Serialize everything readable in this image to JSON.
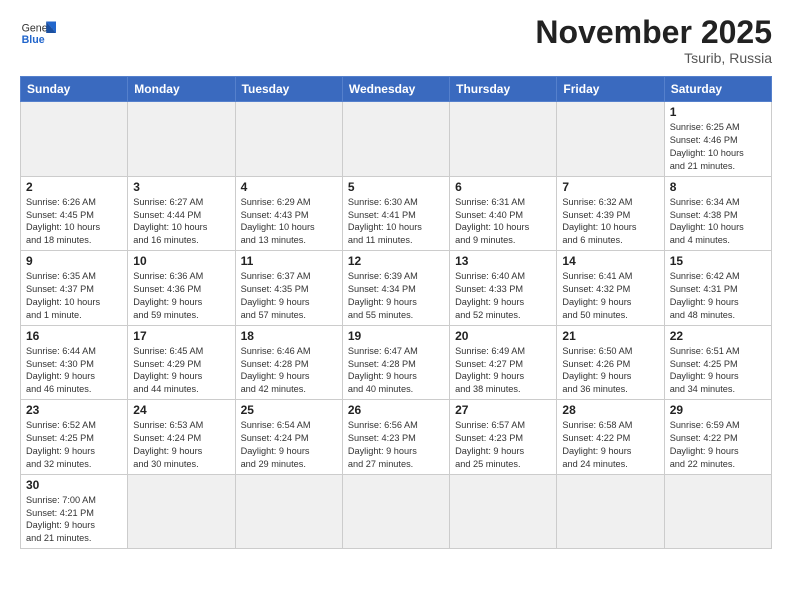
{
  "header": {
    "logo_general": "General",
    "logo_blue": "Blue",
    "month": "November 2025",
    "location": "Tsurib, Russia"
  },
  "weekdays": [
    "Sunday",
    "Monday",
    "Tuesday",
    "Wednesday",
    "Thursday",
    "Friday",
    "Saturday"
  ],
  "days": [
    {
      "num": "",
      "info": ""
    },
    {
      "num": "",
      "info": ""
    },
    {
      "num": "",
      "info": ""
    },
    {
      "num": "",
      "info": ""
    },
    {
      "num": "",
      "info": ""
    },
    {
      "num": "",
      "info": ""
    },
    {
      "num": "1",
      "info": "Sunrise: 6:25 AM\nSunset: 4:46 PM\nDaylight: 10 hours\nand 21 minutes."
    },
    {
      "num": "2",
      "info": "Sunrise: 6:26 AM\nSunset: 4:45 PM\nDaylight: 10 hours\nand 18 minutes."
    },
    {
      "num": "3",
      "info": "Sunrise: 6:27 AM\nSunset: 4:44 PM\nDaylight: 10 hours\nand 16 minutes."
    },
    {
      "num": "4",
      "info": "Sunrise: 6:29 AM\nSunset: 4:43 PM\nDaylight: 10 hours\nand 13 minutes."
    },
    {
      "num": "5",
      "info": "Sunrise: 6:30 AM\nSunset: 4:41 PM\nDaylight: 10 hours\nand 11 minutes."
    },
    {
      "num": "6",
      "info": "Sunrise: 6:31 AM\nSunset: 4:40 PM\nDaylight: 10 hours\nand 9 minutes."
    },
    {
      "num": "7",
      "info": "Sunrise: 6:32 AM\nSunset: 4:39 PM\nDaylight: 10 hours\nand 6 minutes."
    },
    {
      "num": "8",
      "info": "Sunrise: 6:34 AM\nSunset: 4:38 PM\nDaylight: 10 hours\nand 4 minutes."
    },
    {
      "num": "9",
      "info": "Sunrise: 6:35 AM\nSunset: 4:37 PM\nDaylight: 10 hours\nand 1 minute."
    },
    {
      "num": "10",
      "info": "Sunrise: 6:36 AM\nSunset: 4:36 PM\nDaylight: 9 hours\nand 59 minutes."
    },
    {
      "num": "11",
      "info": "Sunrise: 6:37 AM\nSunset: 4:35 PM\nDaylight: 9 hours\nand 57 minutes."
    },
    {
      "num": "12",
      "info": "Sunrise: 6:39 AM\nSunset: 4:34 PM\nDaylight: 9 hours\nand 55 minutes."
    },
    {
      "num": "13",
      "info": "Sunrise: 6:40 AM\nSunset: 4:33 PM\nDaylight: 9 hours\nand 52 minutes."
    },
    {
      "num": "14",
      "info": "Sunrise: 6:41 AM\nSunset: 4:32 PM\nDaylight: 9 hours\nand 50 minutes."
    },
    {
      "num": "15",
      "info": "Sunrise: 6:42 AM\nSunset: 4:31 PM\nDaylight: 9 hours\nand 48 minutes."
    },
    {
      "num": "16",
      "info": "Sunrise: 6:44 AM\nSunset: 4:30 PM\nDaylight: 9 hours\nand 46 minutes."
    },
    {
      "num": "17",
      "info": "Sunrise: 6:45 AM\nSunset: 4:29 PM\nDaylight: 9 hours\nand 44 minutes."
    },
    {
      "num": "18",
      "info": "Sunrise: 6:46 AM\nSunset: 4:28 PM\nDaylight: 9 hours\nand 42 minutes."
    },
    {
      "num": "19",
      "info": "Sunrise: 6:47 AM\nSunset: 4:28 PM\nDaylight: 9 hours\nand 40 minutes."
    },
    {
      "num": "20",
      "info": "Sunrise: 6:49 AM\nSunset: 4:27 PM\nDaylight: 9 hours\nand 38 minutes."
    },
    {
      "num": "21",
      "info": "Sunrise: 6:50 AM\nSunset: 4:26 PM\nDaylight: 9 hours\nand 36 minutes."
    },
    {
      "num": "22",
      "info": "Sunrise: 6:51 AM\nSunset: 4:25 PM\nDaylight: 9 hours\nand 34 minutes."
    },
    {
      "num": "23",
      "info": "Sunrise: 6:52 AM\nSunset: 4:25 PM\nDaylight: 9 hours\nand 32 minutes."
    },
    {
      "num": "24",
      "info": "Sunrise: 6:53 AM\nSunset: 4:24 PM\nDaylight: 9 hours\nand 30 minutes."
    },
    {
      "num": "25",
      "info": "Sunrise: 6:54 AM\nSunset: 4:24 PM\nDaylight: 9 hours\nand 29 minutes."
    },
    {
      "num": "26",
      "info": "Sunrise: 6:56 AM\nSunset: 4:23 PM\nDaylight: 9 hours\nand 27 minutes."
    },
    {
      "num": "27",
      "info": "Sunrise: 6:57 AM\nSunset: 4:23 PM\nDaylight: 9 hours\nand 25 minutes."
    },
    {
      "num": "28",
      "info": "Sunrise: 6:58 AM\nSunset: 4:22 PM\nDaylight: 9 hours\nand 24 minutes."
    },
    {
      "num": "29",
      "info": "Sunrise: 6:59 AM\nSunset: 4:22 PM\nDaylight: 9 hours\nand 22 minutes."
    },
    {
      "num": "30",
      "info": "Sunrise: 7:00 AM\nSunset: 4:21 PM\nDaylight: 9 hours\nand 21 minutes."
    }
  ]
}
